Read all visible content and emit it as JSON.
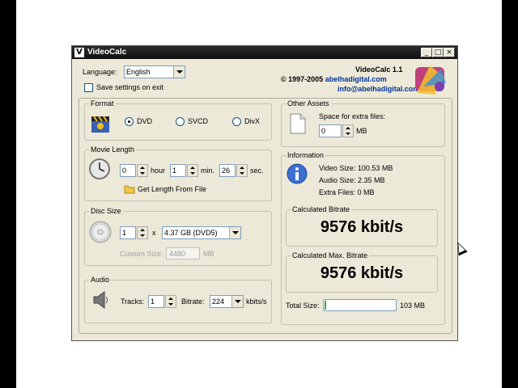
{
  "window": {
    "title": "VideoCalc",
    "app_icon_letter": "V",
    "title_buttons": {
      "minimize": "_",
      "maximize": "□",
      "close": "×"
    }
  },
  "header": {
    "language_label": "Language:",
    "language_value": "English",
    "save_settings_label": "Save settings on exit",
    "save_settings_checked": false,
    "app_name": "VideoCalc 1.1",
    "copyright": "© 1997-2005",
    "website": "abelhadigital.com",
    "email": "info@abelhadigital.com"
  },
  "format": {
    "title": "Format",
    "options": [
      "DVD",
      "SVCD",
      "DivX"
    ],
    "selected": "DVD"
  },
  "movie_length": {
    "title": "Movie Length",
    "hours": "0",
    "hour_label": "hour",
    "minutes": "1",
    "min_label": "min.",
    "seconds": "26",
    "sec_label": "sec.",
    "get_length_label": "Get Length From File"
  },
  "disc_size": {
    "title": "Disc Size",
    "count": "1",
    "times": "x",
    "disc_value": "4.37 GB (DVD5)",
    "custom_size_label": "Custom Size:",
    "custom_size_value": "4480",
    "custom_size_unit": "MB"
  },
  "audio": {
    "title": "Audio",
    "tracks_label": "Tracks:",
    "tracks_value": "1",
    "bitrate_label": "Bitrate:",
    "bitrate_value": "224",
    "bitrate_unit": "kbits/s"
  },
  "other_assets": {
    "title": "Other Assets",
    "space_label": "Space for extra files:",
    "space_value": "0",
    "space_unit": "MB"
  },
  "information": {
    "title": "Information",
    "video_size": "Video Size: 100.53 MB",
    "audio_size": "Audio Size: 2.35 MB",
    "extra_files": "Extra Files: 0 MB"
  },
  "calculated_bitrate": {
    "title": "Calculated Bitrate",
    "value": "9576 kbit/s"
  },
  "calculated_max_bitrate": {
    "title": "Calculated Max. Bitrate",
    "value": "9576 kbit/s"
  },
  "total_size": {
    "label": "Total Size:",
    "value": "103 MB",
    "progress_fraction": 0.02
  },
  "icons": [
    "clapperboard-icon",
    "clock-icon",
    "folder-icon",
    "disc-icon",
    "speaker-icon",
    "document-icon",
    "info-icon",
    "logo-icon"
  ]
}
